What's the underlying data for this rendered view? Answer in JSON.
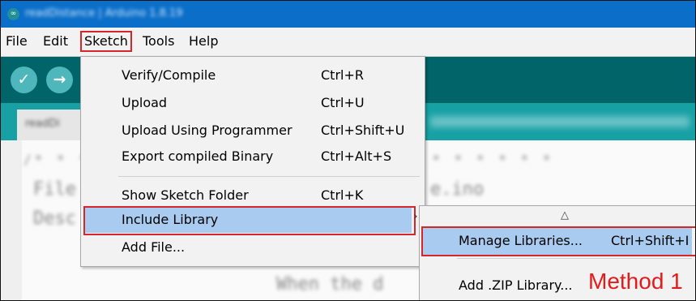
{
  "window": {
    "title": "readDistance | Arduino 1.8.19"
  },
  "menubar": {
    "items": [
      {
        "label": "File"
      },
      {
        "label": "Edit"
      },
      {
        "label": "Sketch"
      },
      {
        "label": "Tools"
      },
      {
        "label": "Help"
      }
    ]
  },
  "toolbar": {
    "verify_icon": "check-icon",
    "upload_icon": "arrow-right-icon"
  },
  "sketch_menu": {
    "items": [
      {
        "label": "Verify/Compile",
        "shortcut": "Ctrl+R"
      },
      {
        "label": "Upload",
        "shortcut": "Ctrl+U"
      },
      {
        "label": "Upload Using Programmer",
        "shortcut": "Ctrl+Shift+U"
      },
      {
        "label": "Export compiled Binary",
        "shortcut": "Ctrl+Alt+S"
      },
      {
        "label": "Show Sketch Folder",
        "shortcut": "Ctrl+K"
      },
      {
        "label": "Include Library",
        "shortcut": ""
      },
      {
        "label": "Add File...",
        "shortcut": ""
      }
    ]
  },
  "include_library_submenu": {
    "scroll_indicator": "△",
    "items": [
      {
        "label": "Manage Libraries...",
        "shortcut": "Ctrl+Shift+I"
      },
      {
        "label": "Add .ZIP Library...",
        "shortcut": ""
      }
    ]
  },
  "annotation": {
    "label": "Method 1",
    "color": "#e31b1b"
  },
  "colors": {
    "titlebar": "#0b6fc9",
    "toolbar": "#006468",
    "tabbar": "#17a1a5",
    "highlight": "#a9cbef",
    "outline": "#d6262a"
  }
}
